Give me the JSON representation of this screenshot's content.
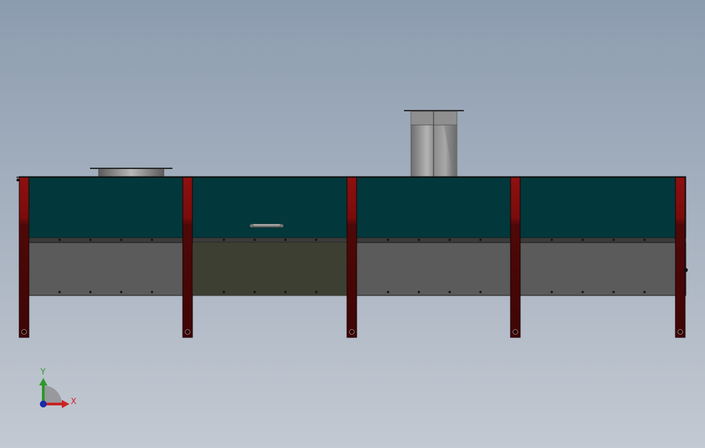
{
  "viewport": {
    "background_top": "#8c9caf",
    "background_bottom": "#c3c9d2"
  },
  "model": {
    "colors": {
      "panel_teal": "#02383b",
      "lower_panel": "#5c5c5c",
      "lower_panel_dark": "#3d3f33",
      "strip": "#3d3d3d",
      "post_red": "#8a1010",
      "post_dark": "#4a0606",
      "duct_metal": "#8a8a8a",
      "plate_metal": "#a0a0a0"
    }
  },
  "triad": {
    "x_label": "X",
    "y_label": "Y",
    "x_color": "#cc2222",
    "y_color": "#2a9a2a",
    "origin_color": "#1a2aa8"
  }
}
